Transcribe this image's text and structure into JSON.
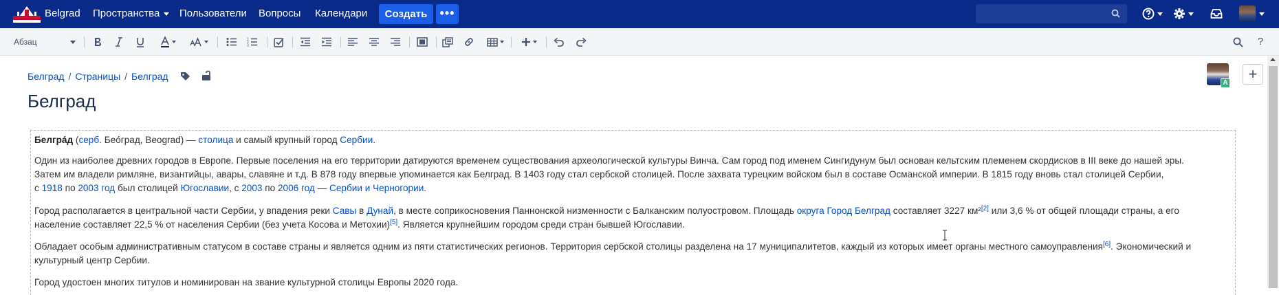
{
  "nav": {
    "site_name": "Belgrad",
    "items": [
      {
        "label": "Пространства",
        "has_caret": true
      },
      {
        "label": "Пользователи",
        "has_caret": false
      },
      {
        "label": "Вопросы",
        "has_caret": false
      },
      {
        "label": "Календари",
        "has_caret": false
      }
    ],
    "create_label": "Создать",
    "more_label": "•••",
    "search_placeholder": "",
    "icons": [
      "help-icon",
      "settings-icon",
      "notifications-icon"
    ],
    "colors": {
      "bar": "#0a2a8a",
      "create": "#1b5ee8"
    }
  },
  "toolbar": {
    "paragraph_style": "Абзац",
    "buttons": [
      "bold",
      "italic",
      "underline",
      "text-color",
      "text-size",
      "bullet-list",
      "numbered-list",
      "task-list",
      "outdent",
      "indent",
      "align-left",
      "align-center",
      "align-right",
      "page-layout",
      "insert-macro",
      "link",
      "table",
      "insert-more",
      "undo",
      "redo",
      "find-replace",
      "help"
    ]
  },
  "breadcrumb": [
    "Белград",
    "Страницы",
    "Белград"
  ],
  "page": {
    "title": "Белград",
    "editor_badge": "A",
    "plus_label": "+"
  },
  "article": {
    "p1": {
      "bold": "Белгра́д",
      "open": "(",
      "lang_link": "серб.",
      "native": " Бео́град, Beograd) — ",
      "capital_link": "столица",
      "mid": " и самый крупный город ",
      "country_link": "Сербии",
      "end": "."
    },
    "p2": {
      "line1": "Один из наиболее древних городов в Европе. Первые поселения на его территории датируются временем существования археологической культуры Винча. Сам город под именем Сингидунум был основан кельтским племенем скордисков в III веке до нашей эры.",
      "line2": "Затем им владели римляне, византийцы, авары, славяне и т.д. В 878 году впервые упоминается как Белград. В 1403 году стал сербской столицей. После захвата турецким войском был в составе Османской империи. В 1815 году вновь стал столицей Сербии,",
      "l3_a": "с ",
      "l3_y1918": "1918",
      "l3_b": " по ",
      "l3_y2003a": "2003 год",
      "l3_c": " был столицей ",
      "l3_yugo": "Югославии",
      "l3_d": ", с ",
      "l3_y2003b": "2003",
      "l3_e": " по ",
      "l3_y2006": "2006 год",
      "l3_f": " — ",
      "l3_scg": "Сербии и Черногории",
      "l3_g": "."
    },
    "p3": {
      "a": "Город располагается в центральной части Сербии, у впадения реки ",
      "sava": "Савы",
      "b": " в ",
      "danube": "Дунай",
      "c": ", в месте соприкосновения Паннонской низменности с Балканским полуостровом. Площадь ",
      "okrug": "округа Город Белград",
      "d": " составляет 3227 км²",
      "ref2": "[2]",
      "e": " или 3,6 % от общей площади страны, а его",
      "line2_a": "население составляет 22,5 % от населения Сербии (без учета Косова и Метохии)",
      "ref5": "[5]",
      "line2_b": ". Является крупнейшим городом среди стран бывшей Югославии."
    },
    "p4": {
      "a": "Обладает особым административным статусом в составе страны и является одним из пяти статистических регионов. Территория сербской столицы разделена на 17 муниципалитетов, каждый из которых имеет органы местного самоуправления",
      "ref6": "[6]",
      "b": ". Экономический и",
      "line2": "культурный центр Сербии."
    },
    "p5": "Город удостоен многих титулов и номинирован на звание культурной столицы Европы 2020 года."
  }
}
